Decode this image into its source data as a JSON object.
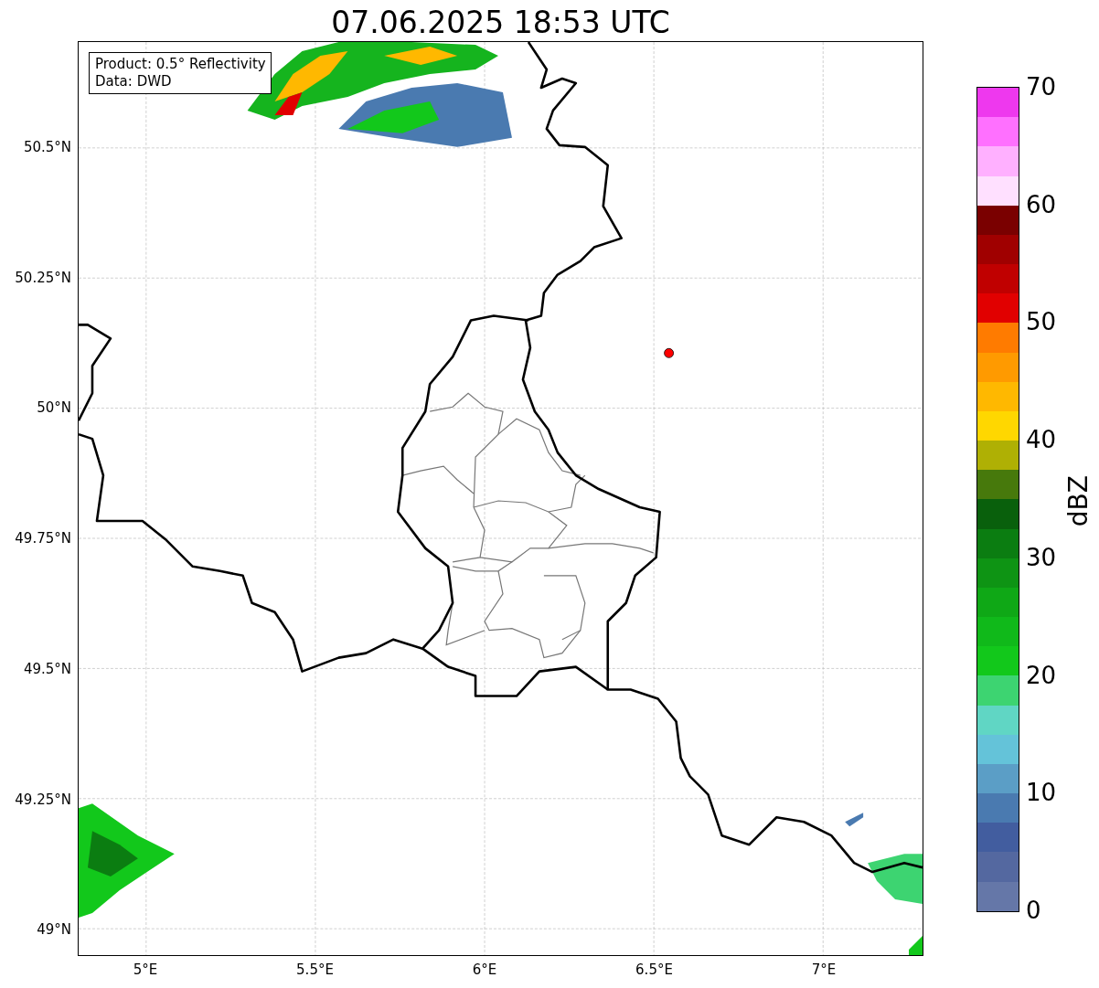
{
  "title": "07.06.2025 18:53 UTC",
  "info_box": {
    "lines": [
      "Product: 0.5° Reflectivity",
      "Data: DWD"
    ]
  },
  "map": {
    "x_ticks": [
      "5°E",
      "5.5°E",
      "6°E",
      "6.5°E",
      "7°E"
    ],
    "y_ticks": [
      "50.5°N",
      "50.25°N",
      "50°N",
      "49.75°N",
      "49.5°N",
      "49.25°N",
      "49°N"
    ]
  },
  "colorbar": {
    "label": "dBZ",
    "ticks": [
      "70",
      "60",
      "50",
      "40",
      "30",
      "20",
      "10",
      "0"
    ],
    "segments": [
      {
        "color": "#ee38ee"
      },
      {
        "color": "#ff70ff"
      },
      {
        "color": "#ffb0ff"
      },
      {
        "color": "#ffe0ff"
      },
      {
        "color": "#7a0000"
      },
      {
        "color": "#a00000"
      },
      {
        "color": "#c00000"
      },
      {
        "color": "#e10000"
      },
      {
        "color": "#ff7b00"
      },
      {
        "color": "#ff9a00"
      },
      {
        "color": "#ffb800"
      },
      {
        "color": "#ffd700"
      },
      {
        "color": "#afb004"
      },
      {
        "color": "#47790c"
      },
      {
        "color": "#09600c"
      },
      {
        "color": "#0b7d11"
      },
      {
        "color": "#0e9414"
      },
      {
        "color": "#0fa816"
      },
      {
        "color": "#10b91a"
      },
      {
        "color": "#12c81b"
      },
      {
        "color": "#3dd471"
      },
      {
        "color": "#60d6c4"
      },
      {
        "color": "#64c3d9"
      },
      {
        "color": "#5b9ec6"
      },
      {
        "color": "#4a7ab0"
      },
      {
        "color": "#425d9f"
      },
      {
        "color": "#5468a0"
      },
      {
        "color": "#6577a8"
      }
    ]
  }
}
